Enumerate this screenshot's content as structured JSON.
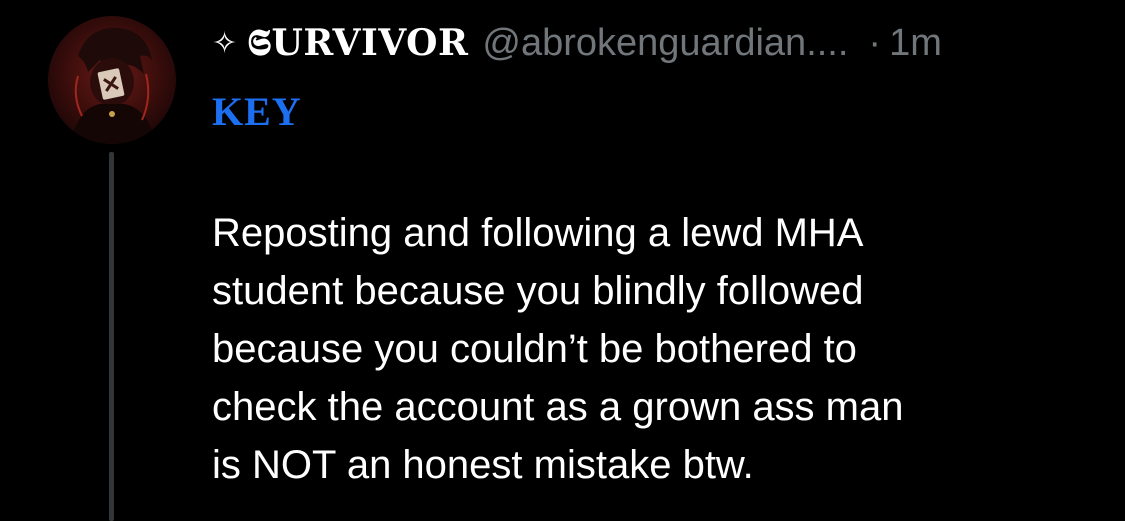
{
  "post": {
    "display_name_prefix": "✧",
    "display_name": "𝕾URVIVOR",
    "handle": "@abrokenguardian....",
    "separator": "·",
    "time": "1m",
    "tag": "KEY",
    "body_lines": [
      "Reposting and following a lewd MHA",
      "student because you blindly followed",
      "because you couldn’t be bothered to",
      "check the account as a grown ass man",
      "is NOT an honest mistake btw."
    ]
  },
  "colors": {
    "background": "#000000",
    "text": "#ffffff",
    "muted": "#71767b",
    "tag": "#1d6ff2",
    "thread_line": "#333639"
  },
  "icons": {
    "avatar": "avatar-image",
    "prefix": "sparkle-icon"
  }
}
